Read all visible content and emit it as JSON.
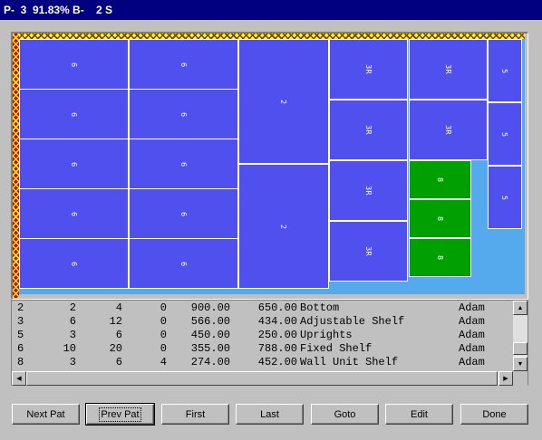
{
  "title_bar": {
    "text": "P-  3  91.83% B-    2 S"
  },
  "pieces": [
    {
      "name": "piece-6",
      "label": "6",
      "color": "blue"
    },
    {
      "name": "piece-6",
      "label": "6",
      "color": "blue"
    },
    {
      "name": "piece-6",
      "label": "6",
      "color": "blue"
    },
    {
      "name": "piece-6",
      "label": "6",
      "color": "blue"
    },
    {
      "name": "piece-6",
      "label": "6",
      "color": "blue"
    },
    {
      "name": "piece-6",
      "label": "6",
      "color": "blue"
    },
    {
      "name": "piece-6",
      "label": "6",
      "color": "blue"
    },
    {
      "name": "piece-6",
      "label": "6",
      "color": "blue"
    },
    {
      "name": "piece-6",
      "label": "6",
      "color": "blue"
    },
    {
      "name": "piece-6",
      "label": "6",
      "color": "blue"
    },
    {
      "name": "piece-2",
      "label": "2",
      "color": "blue"
    },
    {
      "name": "piece-2",
      "label": "2",
      "color": "blue"
    },
    {
      "name": "piece-3r",
      "label": "3R",
      "color": "blue"
    },
    {
      "name": "piece-3r",
      "label": "3R",
      "color": "blue"
    },
    {
      "name": "piece-3r",
      "label": "3R",
      "color": "blue"
    },
    {
      "name": "piece-3r",
      "label": "3R",
      "color": "blue"
    },
    {
      "name": "piece-3r",
      "label": "3R",
      "color": "blue"
    },
    {
      "name": "piece-3r",
      "label": "3R",
      "color": "blue"
    },
    {
      "name": "piece-8",
      "label": "8",
      "color": "green"
    },
    {
      "name": "piece-8",
      "label": "8",
      "color": "green"
    },
    {
      "name": "piece-8",
      "label": "8",
      "color": "green"
    },
    {
      "name": "piece-5",
      "label": "5",
      "color": "blue"
    },
    {
      "name": "piece-5",
      "label": "5",
      "color": "blue"
    },
    {
      "name": "piece-5",
      "label": "5",
      "color": "blue"
    }
  ],
  "parts_list": {
    "rows": [
      {
        "id": "2",
        "qty": "2",
        "total": "4",
        "extra": "0",
        "length": "900.00",
        "width": "650.00",
        "desc": "Bottom",
        "customer": "Adam"
      },
      {
        "id": "3",
        "qty": "6",
        "total": "12",
        "extra": "0",
        "length": "566.00",
        "width": "434.00",
        "desc": "Adjustable Shelf",
        "customer": "Adam"
      },
      {
        "id": "5",
        "qty": "3",
        "total": "6",
        "extra": "0",
        "length": "450.00",
        "width": "250.00",
        "desc": "Uprights",
        "customer": "Adam"
      },
      {
        "id": "6",
        "qty": "10",
        "total": "20",
        "extra": "0",
        "length": "355.00",
        "width": "788.00",
        "desc": "Fixed Shelf",
        "customer": "Adam"
      },
      {
        "id": "8",
        "qty": "3",
        "total": "6",
        "extra": "4",
        "length": "274.00",
        "width": "452.00",
        "desc": "Wall Unit Shelf",
        "customer": "Adam"
      }
    ]
  },
  "buttons": {
    "next_pat": "Next Pat",
    "prev_pat": "Prev Pat",
    "first": "First",
    "last": "Last",
    "goto": "Goto",
    "edit": "Edit",
    "done": "Done"
  },
  "colors": {
    "blue": "#5050ee",
    "green": "#00a000",
    "waste": "#55aaee",
    "title": "#000080"
  }
}
